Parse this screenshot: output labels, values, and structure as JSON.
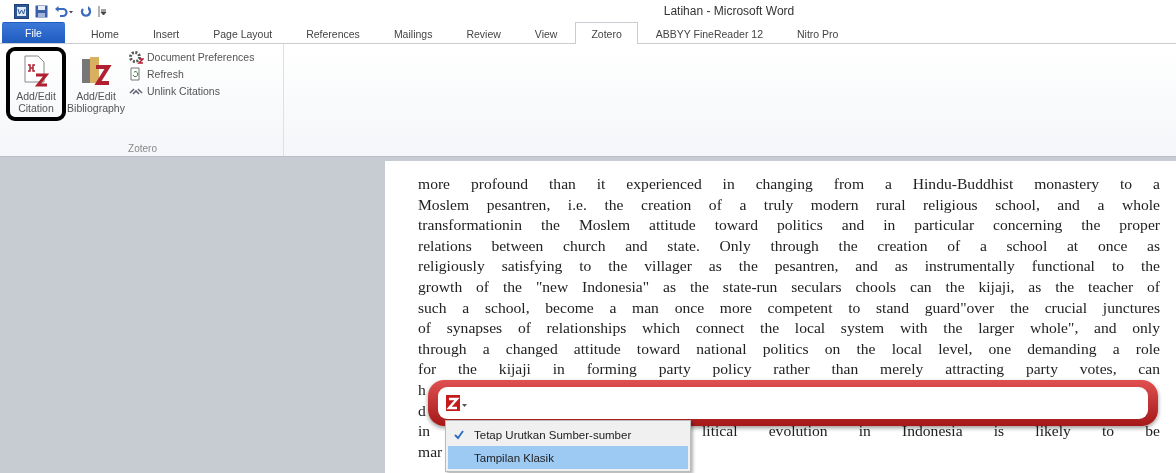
{
  "window": {
    "title": "Latihan - Microsoft Word"
  },
  "tabs": [
    {
      "label": "File",
      "kind": "file",
      "selected": false
    },
    {
      "label": "Home",
      "kind": "tab",
      "selected": false
    },
    {
      "label": "Insert",
      "kind": "tab",
      "selected": false
    },
    {
      "label": "Page Layout",
      "kind": "tab",
      "selected": false
    },
    {
      "label": "References",
      "kind": "tab",
      "selected": false
    },
    {
      "label": "Mailings",
      "kind": "tab",
      "selected": false
    },
    {
      "label": "Review",
      "kind": "tab",
      "selected": false
    },
    {
      "label": "View",
      "kind": "tab",
      "selected": false
    },
    {
      "label": "Zotero",
      "kind": "tab",
      "selected": true
    },
    {
      "label": "ABBYY FineReader 12",
      "kind": "tab",
      "selected": false
    },
    {
      "label": "Nitro Pro",
      "kind": "tab",
      "selected": false
    }
  ],
  "ribbon": {
    "group_label": "Zotero",
    "large_buttons": [
      {
        "label": "Add/Edit Citation",
        "highlighted": true
      },
      {
        "label": "Add/Edit Bibliography",
        "highlighted": false
      }
    ],
    "small_buttons": [
      {
        "label": "Document Preferences",
        "kind": "gear"
      },
      {
        "label": "Refresh",
        "kind": "refresh"
      },
      {
        "label": "Unlink Citations",
        "kind": "unlink"
      }
    ]
  },
  "document": {
    "lines": [
      {
        "kind": "full",
        "text": "more profound than it experienced in changing from a Hindu-Buddhist monastery to a"
      },
      {
        "kind": "full",
        "text": "Moslem pesantren, i.e. the creation of a truly modern rural religious school, and a whole"
      },
      {
        "kind": "full",
        "text": "transformationin the Moslem attitude toward politics and in particular concerning the proper"
      },
      {
        "kind": "full",
        "text": "relations between church and state. Only through the creation of a school at once as"
      },
      {
        "kind": "full",
        "text": "religiously satisfying to the villager as the pesantren, and as instrumentally functional to the"
      },
      {
        "kind": "full",
        "text": "growth of the \"new Indonesia\" as the state-run seculars chools can the kijaji, as the teacher of"
      },
      {
        "kind": "full",
        "text": "such a school, become a man once more competent to stand guard\"over the crucial junctures"
      },
      {
        "kind": "full",
        "text": "of synapses of relationships which connect the local system with the larger whole\", and only"
      },
      {
        "kind": "full",
        "text": "through a changed attitude toward national politics on the local level, one demanding a role"
      },
      {
        "kind": "covered",
        "text": "for the kijaji in forming party policy rather than merely attracting party votes, can"
      },
      {
        "kind": "fragment",
        "text": "h"
      },
      {
        "kind": "fragment",
        "text": "d"
      },
      {
        "kind": "split",
        "text": "in",
        "rest": "litical evolution in Indonesia is likely to be"
      },
      {
        "kind": "fragment",
        "text": "mar"
      }
    ]
  },
  "zotero_bar": {
    "menu": [
      {
        "label": "Tetap Urutkan Sumber-sumber",
        "checked": true,
        "selected": false
      },
      {
        "label": "Tampilan Klasik",
        "checked": false,
        "selected": true
      }
    ]
  }
}
